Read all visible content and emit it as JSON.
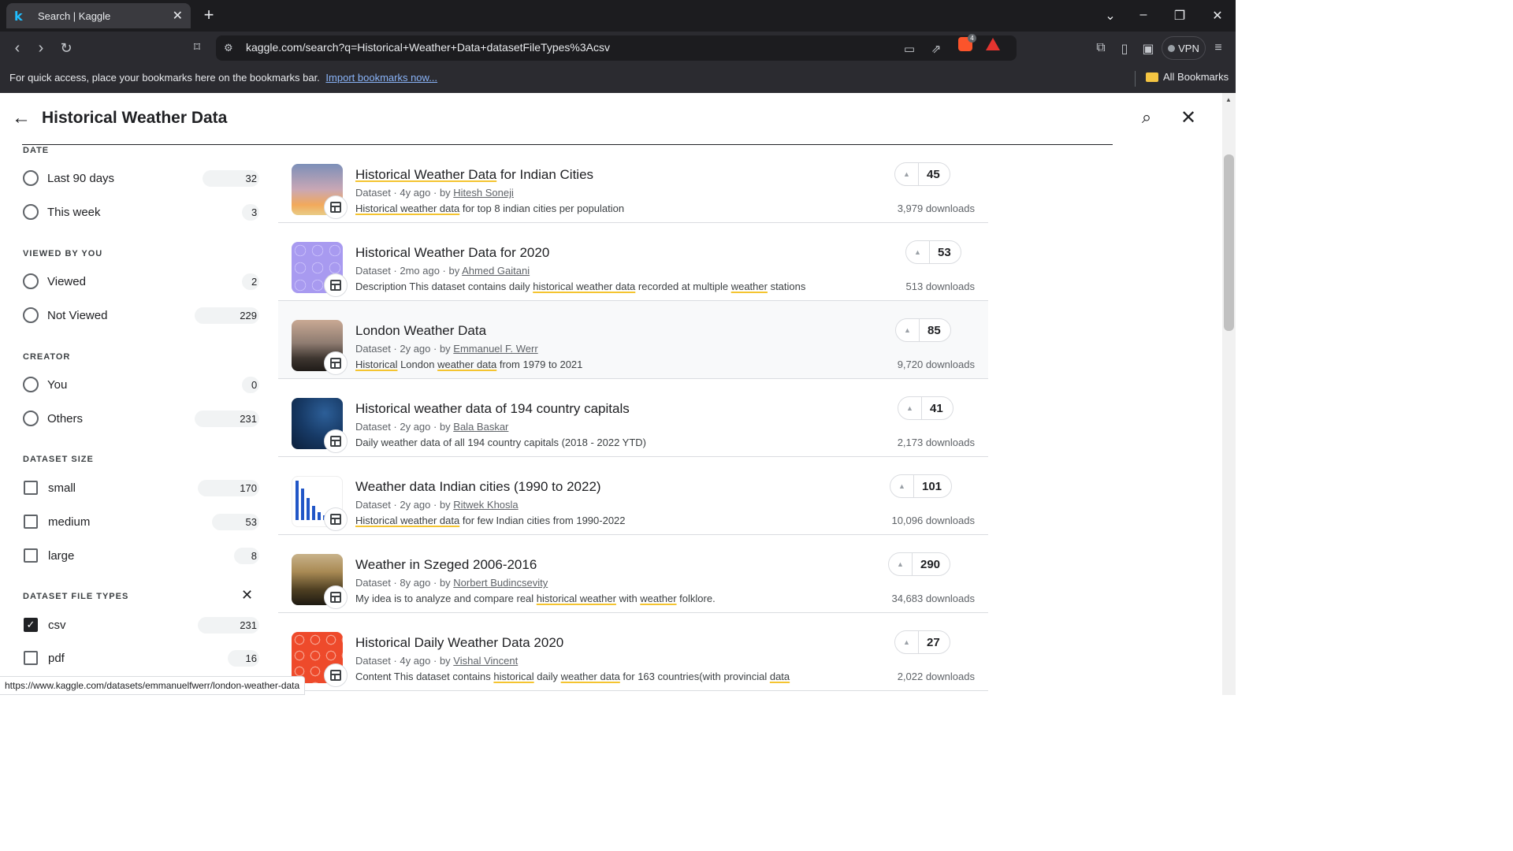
{
  "browser": {
    "tab_title": "Search | Kaggle",
    "tab_icon": "k",
    "url": "kaggle.com/search?q=Historical+Weather+Data+datasetFileTypes%3Acsv",
    "brave_badge": "4",
    "vpn_label": "VPN",
    "bookmarks_msg": "For quick access, place your bookmarks here on the bookmarks bar.",
    "import_link": "Import bookmarks now...",
    "all_bookmarks": "All Bookmarks"
  },
  "search": {
    "query": "Historical Weather Data"
  },
  "filters": {
    "date": {
      "heading": "DATE",
      "options": [
        {
          "label": "Last 90 days",
          "count": "32"
        },
        {
          "label": "This week",
          "count": "3"
        }
      ]
    },
    "viewed": {
      "heading": "VIEWED BY YOU",
      "options": [
        {
          "label": "Viewed",
          "count": "2"
        },
        {
          "label": "Not Viewed",
          "count": "229"
        }
      ]
    },
    "creator": {
      "heading": "CREATOR",
      "options": [
        {
          "label": "You",
          "count": "0"
        },
        {
          "label": "Others",
          "count": "231"
        }
      ]
    },
    "size": {
      "heading": "DATASET SIZE",
      "options": [
        {
          "label": "small",
          "count": "170"
        },
        {
          "label": "medium",
          "count": "53"
        },
        {
          "label": "large",
          "count": "8"
        }
      ]
    },
    "filetypes": {
      "heading": "DATASET FILE TYPES",
      "options": [
        {
          "label": "csv",
          "count": "231",
          "checked": true
        },
        {
          "label": "pdf",
          "count": "16",
          "checked": false
        }
      ]
    }
  },
  "results": [
    {
      "title": "Historical Weather Data for Indian Cities",
      "type": "Dataset",
      "age": "4y ago",
      "author": "Hitesh Soneji",
      "votes": "45",
      "downloads": "3,979 downloads",
      "desc": [
        [
          "Historical weather data",
          true
        ],
        [
          " for top 8 indian cities per population",
          false
        ]
      ]
    },
    {
      "title": "Historical Weather Data for 2020",
      "type": "Dataset",
      "age": "2mo ago",
      "author": "Ahmed Gaitani",
      "votes": "53",
      "downloads": "513 downloads",
      "desc": [
        [
          "Description This dataset contains daily ",
          false
        ],
        [
          "historical weather data",
          true
        ],
        [
          " recorded at multiple ",
          false
        ],
        [
          "weather",
          true
        ],
        [
          " stations",
          false
        ]
      ]
    },
    {
      "title": "London Weather Data",
      "type": "Dataset",
      "age": "2y ago",
      "author": "Emmanuel F. Werr",
      "votes": "85",
      "downloads": "9,720 downloads",
      "desc": [
        [
          "Historical",
          true
        ],
        [
          " London ",
          false
        ],
        [
          "weather data",
          true
        ],
        [
          " from 1979 to 2021",
          false
        ]
      ]
    },
    {
      "title": "Historical weather data of 194 country capitals",
      "type": "Dataset",
      "age": "2y ago",
      "author": "Bala Baskar",
      "votes": "41",
      "downloads": "2,173 downloads",
      "desc": [
        [
          "Daily weather data of all 194 country capitals (2018 - 2022 YTD)",
          false
        ]
      ]
    },
    {
      "title": "Weather data Indian cities (1990 to 2022)",
      "type": "Dataset",
      "age": "2y ago",
      "author": "Ritwek Khosla",
      "votes": "101",
      "downloads": "10,096 downloads",
      "desc": [
        [
          "Historical weather data",
          true
        ],
        [
          " for few Indian cities from 1990-2022",
          false
        ]
      ]
    },
    {
      "title": "Weather in Szeged 2006-2016",
      "type": "Dataset",
      "age": "8y ago",
      "author": "Norbert Budincsevity",
      "votes": "290",
      "downloads": "34,683 downloads",
      "desc": [
        [
          "My idea is to analyze and compare real ",
          false
        ],
        [
          "historical weather",
          true
        ],
        [
          " with ",
          false
        ],
        [
          "weather",
          true
        ],
        [
          " folklore.",
          false
        ]
      ]
    },
    {
      "title": "Historical Daily Weather Data 2020",
      "type": "Dataset",
      "age": "4y ago",
      "author": "Vishal Vincent",
      "votes": "27",
      "downloads": "2,022 downloads",
      "desc": [
        [
          "Content This dataset contains ",
          false
        ],
        [
          "historical",
          true
        ],
        [
          " daily ",
          false
        ],
        [
          "weather data",
          true
        ],
        [
          " for 163 countries(with provincial ",
          false
        ],
        [
          "data",
          true
        ]
      ]
    }
  ],
  "status_url": "https://www.kaggle.com/datasets/emmanuelfwerr/london-weather-data",
  "colors": {
    "highlight_underline": "#f4c430",
    "kaggle_blue": "#20beff"
  }
}
